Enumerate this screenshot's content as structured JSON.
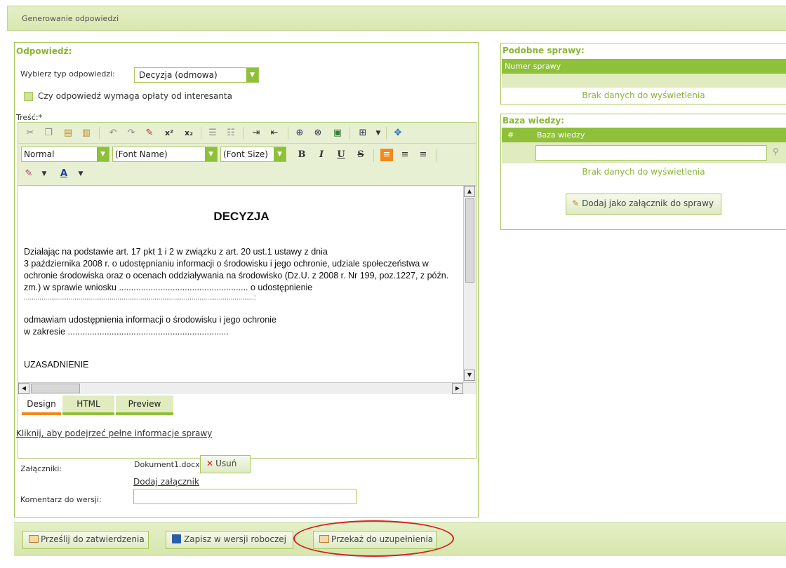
{
  "header": {
    "title": "Generowanie odpowiedzi"
  },
  "response": {
    "title": "Odpowiedź:",
    "type_label": "Wybierz typ odpowiedzi:",
    "type_value": "Decyzja (odmowa)",
    "fee_checkbox_label": "Czy odpowiedź wymaga opłaty od interesanta",
    "content_label": "Treść:*"
  },
  "editor": {
    "style_value": "Normal",
    "font_name_value": "(Font Name)",
    "font_size_value": "(Font Size)",
    "format_buttons": [
      "B",
      "I",
      "U",
      "S"
    ],
    "document": {
      "heading": "DECYZJA",
      "lines": [
        "Działając na podstawie art. 17 pkt 1 i 2 w związku z art. 20 ust.1 ustawy z dnia",
        "3 października 2008 r. o udostępnianiu informacji o środowisku i jego ochronie, udziale społeczeństwa w",
        "ochronie środowiska oraz o ocenach oddziaływania na środowisko (Dz.U. z 2008 r. Nr 199, poz.1227, z późn.",
        "zm.) w sprawie wniosku ..................................................... o udostępnienie",
        "......................................................................................................................:",
        "odmawiam udostępnienia informacji o środowisku i jego ochronie",
        "w zakresie ..................................................................",
        "UZASADNIENIE"
      ]
    },
    "tabs": [
      "Design",
      "HTML",
      "Preview"
    ],
    "active_tab": "Design"
  },
  "case_link": "Kliknij, aby podejrzeć pełne informacje sprawy",
  "attachments": {
    "label": "Załączniki:",
    "file_name": "Dokument1.docx",
    "remove_label": "Usuń",
    "add_link": "Dodaj załącznik"
  },
  "version_comment": {
    "label": "Komentarz do wersji:",
    "value": ""
  },
  "similar_cases": {
    "title": "Podobne sprawy:",
    "column": "Numer sprawy",
    "empty": "Brak danych do wyświetlenia"
  },
  "knowledge_base": {
    "title": "Baza wiedzy:",
    "columns": [
      "#",
      "Baza wiedzy"
    ],
    "filter_value": "",
    "empty": "Brak danych do wyświetlenia",
    "add_button": "Dodaj jako załącznik do sprawy"
  },
  "actions": {
    "submit": "Prześlij do zatwierdzenia",
    "save_draft": "Zapisz w wersji roboczej",
    "handover": "Przekaż do uzupełnienia"
  },
  "colors": {
    "accent": "#8ec03a",
    "active_tab": "#f08a1d",
    "highlight_ellipse": "#d42020"
  }
}
